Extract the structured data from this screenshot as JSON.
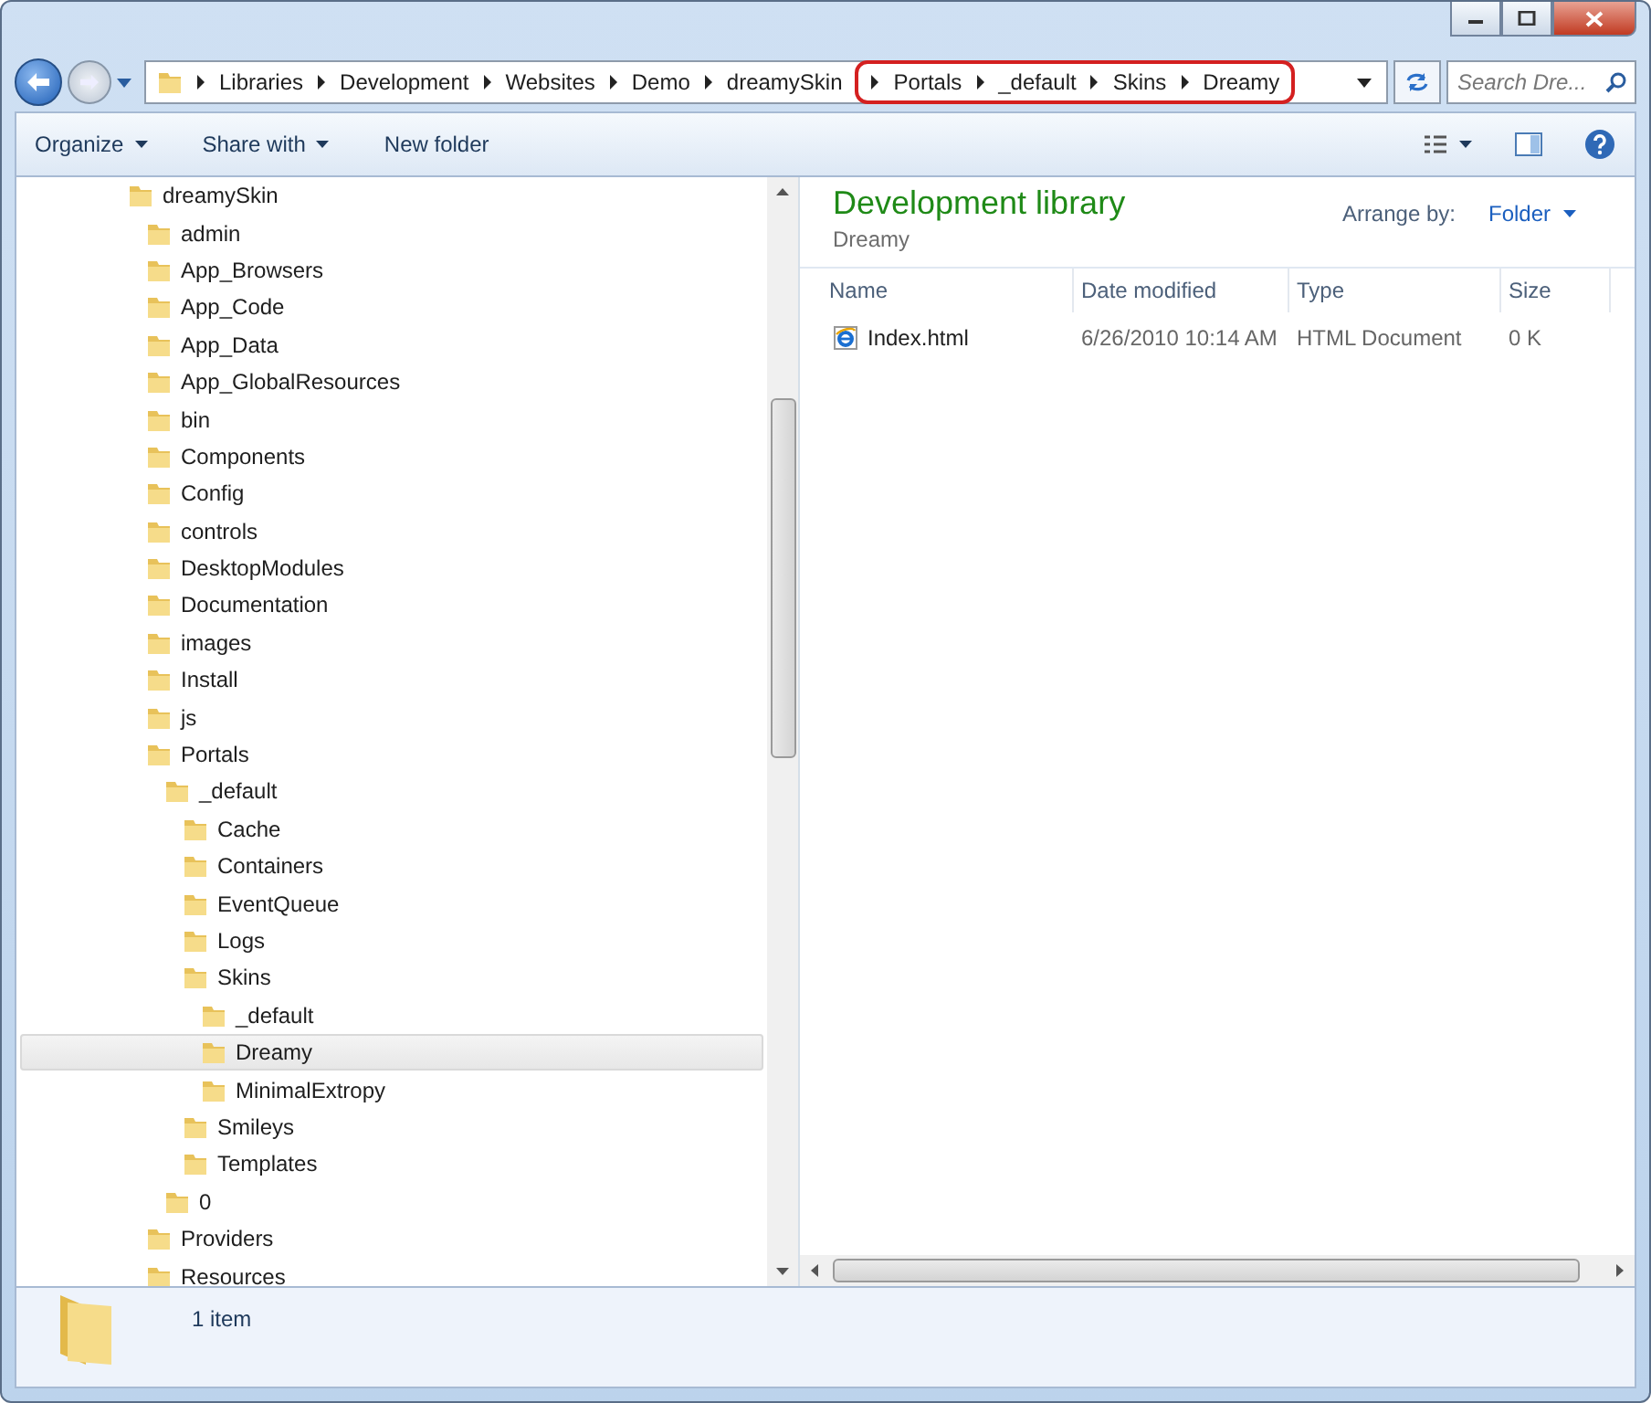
{
  "address_bar": {
    "segments": [
      "Libraries",
      "Development",
      "Websites",
      "Demo",
      "dreamySkin"
    ],
    "highlighted_segments": [
      "Portals",
      "_default",
      "Skins",
      "Dreamy"
    ]
  },
  "search": {
    "placeholder": "Search Dre..."
  },
  "toolbar": {
    "items": [
      {
        "label": "Organize",
        "dropdown": true
      },
      {
        "label": "Share with",
        "dropdown": true
      },
      {
        "label": "New folder",
        "dropdown": false
      }
    ]
  },
  "tree": [
    {
      "label": "dreamySkin",
      "selected": false,
      "children": [
        {
          "label": "admin",
          "selected": false
        },
        {
          "label": "App_Browsers",
          "selected": false
        },
        {
          "label": "App_Code",
          "selected": false
        },
        {
          "label": "App_Data",
          "selected": false
        },
        {
          "label": "App_GlobalResources",
          "selected": false
        },
        {
          "label": "bin",
          "selected": false
        },
        {
          "label": "Components",
          "selected": false
        },
        {
          "label": "Config",
          "selected": false
        },
        {
          "label": "controls",
          "selected": false
        },
        {
          "label": "DesktopModules",
          "selected": false
        },
        {
          "label": "Documentation",
          "selected": false
        },
        {
          "label": "images",
          "selected": false
        },
        {
          "label": "Install",
          "selected": false
        },
        {
          "label": "js",
          "selected": false
        },
        {
          "label": "Portals",
          "selected": false,
          "children": [
            {
              "label": "_default",
              "selected": false,
              "children": [
                {
                  "label": "Cache",
                  "selected": false
                },
                {
                  "label": "Containers",
                  "selected": false
                },
                {
                  "label": "EventQueue",
                  "selected": false
                },
                {
                  "label": "Logs",
                  "selected": false
                },
                {
                  "label": "Skins",
                  "selected": false,
                  "children": [
                    {
                      "label": "_default",
                      "selected": false
                    },
                    {
                      "label": "Dreamy",
                      "selected": true
                    },
                    {
                      "label": "MinimalExtropy",
                      "selected": false
                    }
                  ]
                },
                {
                  "label": "Smileys",
                  "selected": false
                },
                {
                  "label": "Templates",
                  "selected": false
                }
              ]
            },
            {
              "label": "0",
              "selected": false
            }
          ]
        },
        {
          "label": "Providers",
          "selected": false
        },
        {
          "label": "Resources",
          "selected": false
        }
      ]
    }
  ],
  "library": {
    "title": "Development library",
    "subtitle": "Dreamy",
    "arrange_label": "Arrange by:",
    "arrange_value": "Folder"
  },
  "table": {
    "columns": [
      "Name",
      "Date modified",
      "Type",
      "Size"
    ],
    "rows": [
      {
        "name": "Index.html",
        "date": "6/26/2010 10:14 AM",
        "type": "HTML Document",
        "size": "0 K"
      }
    ]
  },
  "status_bar": {
    "text": "1 item"
  }
}
